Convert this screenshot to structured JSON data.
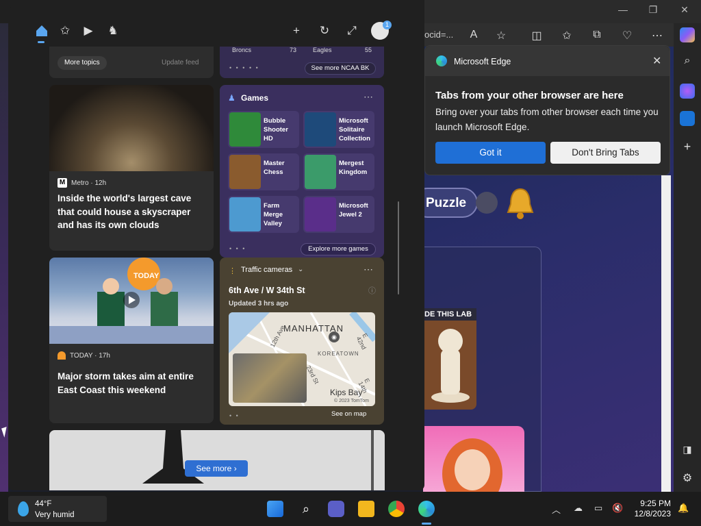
{
  "browser": {
    "address_fragment": "ocid=...",
    "minimize": "—",
    "restore": "❐",
    "close": "✕"
  },
  "background_page": {
    "puzzle_label": "Puzzle",
    "chess_tile_label": "DE THIS LAB"
  },
  "widgets": {
    "topics": {
      "more_topics": "More topics",
      "update_feed": "Update feed"
    },
    "ncaa": {
      "teams": [
        "Broncs",
        "Eagles"
      ],
      "scores": [
        "73",
        "55"
      ],
      "see_more": "See more NCAA BK"
    },
    "news1": {
      "source": "Metro · 12h",
      "logo": "M",
      "headline": "Inside the world's largest cave that could house a skyscraper and has its own clouds"
    },
    "games": {
      "title": "Games",
      "items": [
        {
          "name": "Bubble Shooter HD",
          "color": "#2f8a3a"
        },
        {
          "name": "Microsoft Solitaire Collection",
          "color": "#1e4a7a"
        },
        {
          "name": "Master Chess",
          "color": "#8a5b2e"
        },
        {
          "name": "Mergest Kingdom",
          "color": "#3b9b6a"
        },
        {
          "name": "Farm Merge Valley",
          "color": "#4d9ad0"
        },
        {
          "name": "Microsoft Jewel 2",
          "color": "#5a2e8a"
        }
      ],
      "explore": "Explore more games"
    },
    "news2": {
      "source": "TODAY · 17h",
      "headline": "Major storm takes aim at entire East Coast this weekend",
      "badge": "TODAY"
    },
    "traffic": {
      "title": "Traffic cameras",
      "location": "6th Ave / W 34th St",
      "updated": "Updated 3 hrs ago",
      "map_labels": {
        "manhattan": "MANHATTAN",
        "koreatown": "KOREATOWN",
        "kips": "Kips Bay",
        "credit": "© 2023 TomTom",
        "st12": "12th Ave",
        "st42": "E 42nd",
        "st23": "23rd St",
        "st14": "E 14th"
      },
      "see_map": "See on map"
    },
    "see_more": "See more"
  },
  "popup": {
    "app_name": "Microsoft Edge",
    "heading": "Tabs from your other browser are here",
    "body": "Bring over your tabs from other browser each time you launch Microsoft Edge.",
    "primary": "Got it",
    "secondary": "Don't Bring Tabs"
  },
  "taskbar": {
    "temp": "44°F",
    "condition": "Very humid",
    "time": "9:25 PM",
    "date": "12/8/2023"
  },
  "colors": {
    "accent": "#1f6fd6",
    "games_bg": "#3a2f5e",
    "traffic_bg": "#4a4232"
  }
}
